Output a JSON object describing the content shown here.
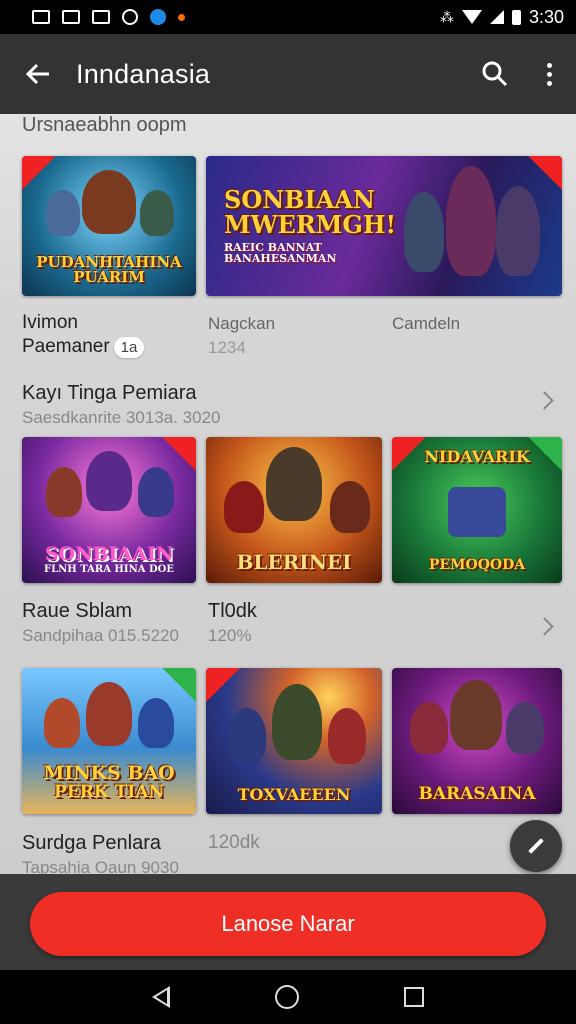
{
  "status_bar": {
    "time": "3:30"
  },
  "app_bar": {
    "title": "Inndanasia"
  },
  "section_heading": "Ursnaeabhn oopm",
  "row1": {
    "tiles": [
      {
        "label": "PUDANHTAHINA PUARIM"
      },
      {
        "label": "SONBIAAN MWERMGH!",
        "sublabel": "RAEIC BANNAT BANAHESANMAN"
      }
    ],
    "meta": [
      {
        "title": "Ivimon",
        "subtitle": "Paemaner",
        "badge": "1a"
      },
      {
        "title": "Nagckan",
        "subtitle": "1234"
      },
      {
        "title": "Camdeln"
      }
    ]
  },
  "section2": {
    "title": "Kayı Tinga Pemiara",
    "subtitle": "Saesdkanrite 3013a. 3020"
  },
  "row2": {
    "tiles": [
      {
        "label": "SONBIAAIN",
        "sublabel": "FLNH TARA HINA DOE"
      },
      {
        "label": "BLERINEI"
      },
      {
        "label": "NIDAVARIK",
        "sublabel": "PEMOQODA"
      }
    ],
    "meta": [
      {
        "title": "Raue Sblam",
        "subtitle": "Sandpihaa 015.5220"
      },
      {
        "title": "Tl0dk",
        "subtitle": "120%"
      }
    ]
  },
  "row3": {
    "tiles": [
      {
        "label": "MINKS BAO",
        "sublabel": "PERK TIAN"
      },
      {
        "label": "TOXVAEEEN"
      },
      {
        "label": "BARASAINA"
      }
    ],
    "meta": [
      {
        "title": "Surdga Penlara",
        "subtitle": "Tapsahia Oaun 9030"
      },
      {
        "title": "120dk"
      }
    ]
  },
  "cta": {
    "label": "Lanose Narar"
  },
  "colors": {
    "accent": "#ef2e25",
    "app_bar": "#333333"
  },
  "icons": [
    "back-arrow-icon",
    "search-icon",
    "more-vert-icon",
    "pencil-icon",
    "chevron-right-icon"
  ]
}
